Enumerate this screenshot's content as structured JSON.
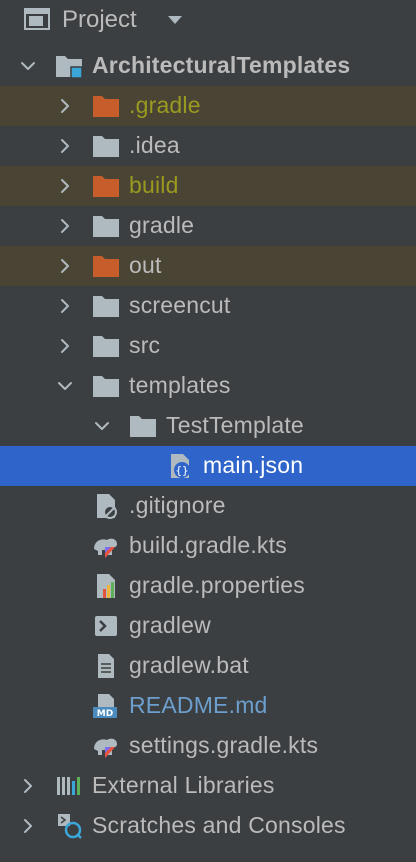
{
  "header": {
    "title": "Project"
  },
  "tree": [
    {
      "label": "ArchitecturalTemplates",
      "icon": "module-folder-icon",
      "chevron": "down",
      "bold": true
    },
    {
      "label": ".gradle",
      "icon": "excluded-folder-icon",
      "chevron": "right",
      "style": "ignored"
    },
    {
      "label": ".idea",
      "icon": "folder-icon",
      "chevron": "right"
    },
    {
      "label": "build",
      "icon": "excluded-folder-icon",
      "chevron": "right",
      "style": "ignored"
    },
    {
      "label": "gradle",
      "icon": "folder-icon",
      "chevron": "right"
    },
    {
      "label": "out",
      "icon": "excluded-folder-icon",
      "chevron": "right",
      "style": "ignored-plain"
    },
    {
      "label": "screencut",
      "icon": "folder-icon",
      "chevron": "right"
    },
    {
      "label": "src",
      "icon": "folder-icon",
      "chevron": "right"
    },
    {
      "label": "templates",
      "icon": "folder-icon",
      "chevron": "down"
    },
    {
      "label": "TestTemplate",
      "icon": "folder-icon",
      "chevron": "down"
    },
    {
      "label": "main.json",
      "icon": "json-file-icon",
      "chevron": "none",
      "selected": true
    },
    {
      "label": ".gitignore",
      "icon": "gitignore-file-icon",
      "chevron": "none"
    },
    {
      "label": "build.gradle.kts",
      "icon": "gradle-kts-file-icon",
      "chevron": "none"
    },
    {
      "label": "gradle.properties",
      "icon": "properties-file-icon",
      "chevron": "none"
    },
    {
      "label": "gradlew",
      "icon": "shell-script-icon",
      "chevron": "none"
    },
    {
      "label": "gradlew.bat",
      "icon": "text-file-icon",
      "chevron": "none"
    },
    {
      "label": "README.md",
      "icon": "markdown-file-icon",
      "chevron": "none",
      "style": "modified"
    },
    {
      "label": "settings.gradle.kts",
      "icon": "gradle-kts-file-icon",
      "chevron": "none"
    },
    {
      "label": "External Libraries",
      "icon": "libraries-icon",
      "chevron": "right"
    },
    {
      "label": "Scratches and Consoles",
      "icon": "scratches-icon",
      "chevron": "right"
    }
  ],
  "colors": {
    "background": "#3c3f41",
    "selection": "#2f65ca",
    "ignored_row": "#4a4434",
    "ignored_text": "#9a9a20",
    "modified_text": "#6d9fce",
    "excluded_folder": "#c65d2b",
    "folder": "#aeb9c0"
  }
}
